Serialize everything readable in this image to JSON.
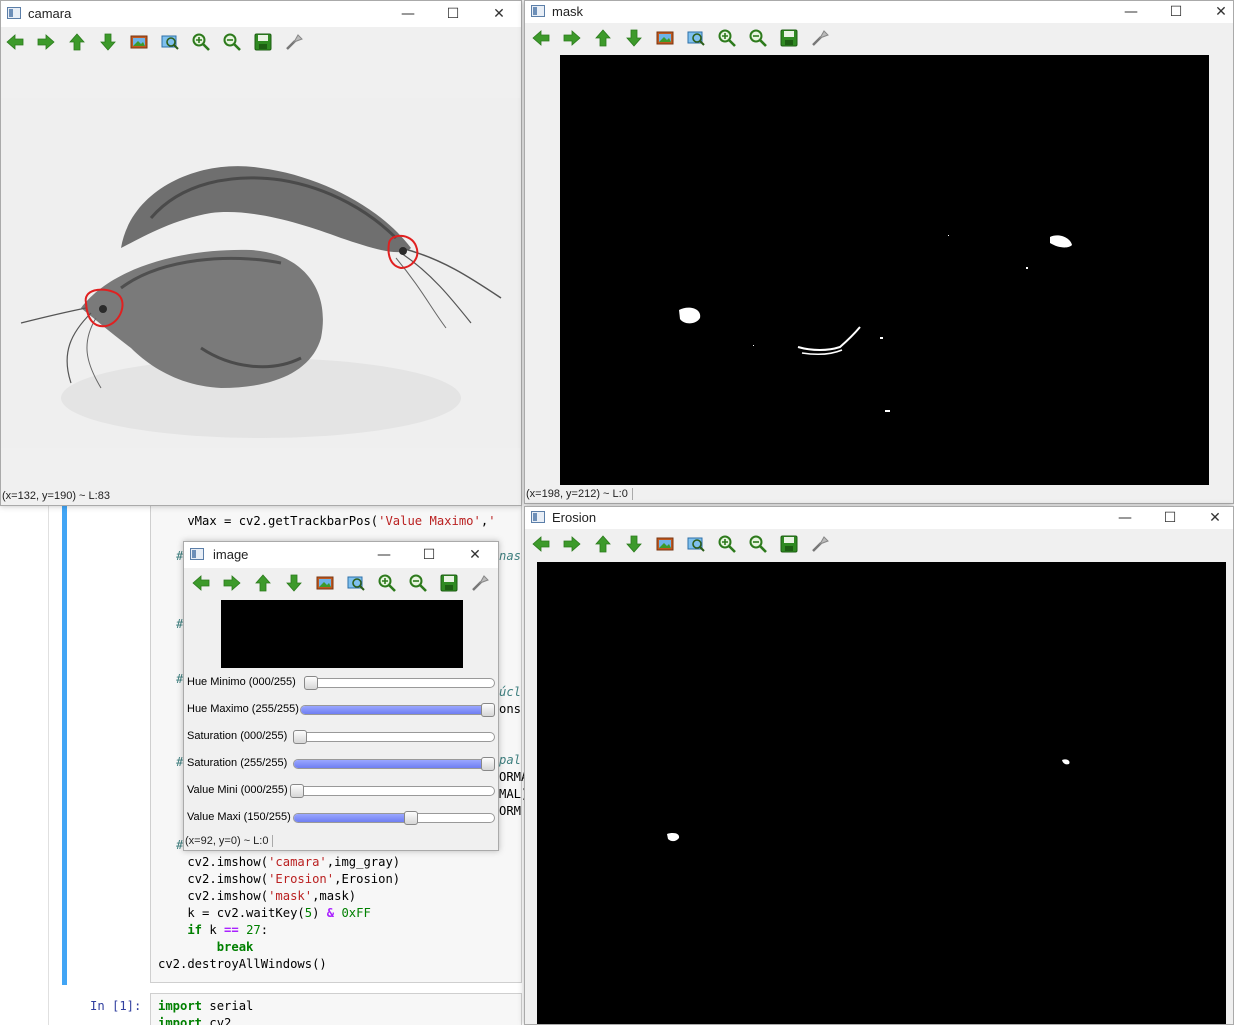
{
  "notebook": {
    "code_lines": [
      {
        "pre": "    vMax = cv2.getTrackbarPos(",
        "str": "'Value Maximo'",
        "post": ",",
        "str2": "'"
      },
      {
        "text": "    cv2.imshow(",
        "str": "'camara'",
        "post": ",img_gray)"
      },
      {
        "text": "    cv2.imshow(",
        "str": "'Erosion'",
        "post": ",Erosion)"
      },
      {
        "text": "    cv2.imshow(",
        "str": "'mask'",
        "post": ",mask)"
      },
      {
        "text": "    k = cv2.waitKey(",
        "num": "5",
        "post": ") ",
        "op": "&",
        "post2": " ",
        "num2": "0xFF"
      },
      {
        "kw": "    if",
        "text": " k ",
        "op": "==",
        "post": " ",
        "num": "27",
        "post2": ":"
      },
      {
        "kw": "        break"
      },
      {
        "text": "cv2.destroyAllWindows()"
      }
    ],
    "prompt2": "In [1]:",
    "import_line1_kw": "import",
    "import_line1_mod": " serial",
    "import_line2_kw": "import",
    "import_line2_mod": " cv2",
    "partial_fragments": [
      "nas",
      "úcl",
      "ons",
      "pal",
      "ORMA",
      "MAL)",
      "ORM"
    ]
  },
  "windows": {
    "camara": {
      "title": "camara",
      "status": "(x=132, y=190) ~ L:83",
      "status_level": ""
    },
    "mask": {
      "title": "mask",
      "status": "(x=198, y=212) ~ L:0"
    },
    "erosion": {
      "title": "Erosion"
    },
    "image": {
      "title": "image",
      "status": "(x=92, y=0) ~ L:0",
      "trackbars": [
        {
          "label": "Hue Minimo (000/255)",
          "value": 0,
          "max": 255
        },
        {
          "label": "Hue Maximo (255/255)",
          "value": 255,
          "max": 255
        },
        {
          "label": "Saturation (000/255)",
          "value": 0,
          "max": 255
        },
        {
          "label": "Saturation (255/255)",
          "value": 255,
          "max": 255
        },
        {
          "label": "Value Mini (000/255)",
          "value": 0,
          "max": 255
        },
        {
          "label": "Value Maxi (150/255)",
          "value": 150,
          "max": 255
        }
      ]
    }
  },
  "window_buttons": {
    "minimize": "—",
    "maximize": "☐",
    "close": "✕"
  },
  "toolbar_icons": [
    "arrow-left-icon",
    "arrow-right-icon",
    "arrow-up-icon",
    "arrow-down-icon",
    "image-icon",
    "zoom-fit-icon",
    "zoom-in-icon",
    "zoom-out-icon",
    "save-icon",
    "properties-icon"
  ],
  "colors": {
    "accent": "#42a5f5",
    "slider_fill": "#7b88f6",
    "title_text": "#222222"
  }
}
